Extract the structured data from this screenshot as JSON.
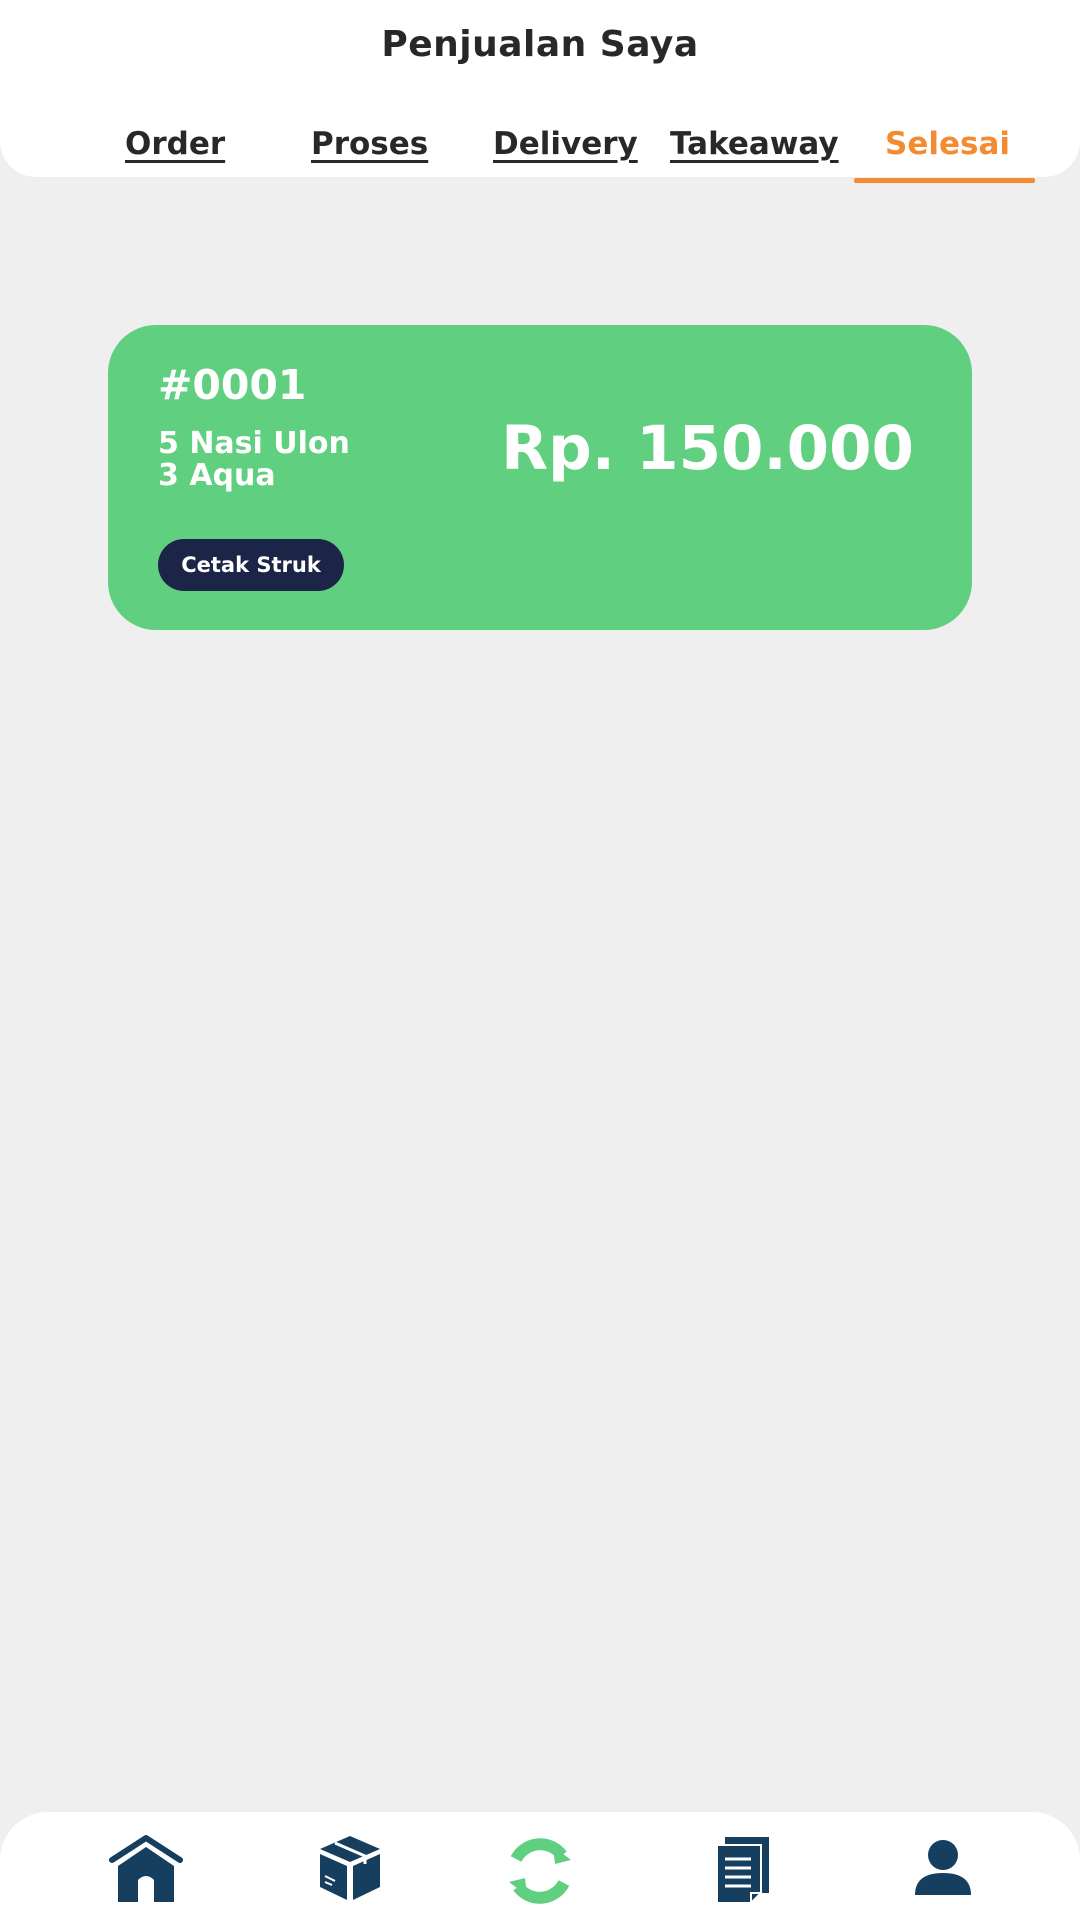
{
  "header": {
    "title": "Penjualan Saya",
    "tabs": [
      {
        "label": "Order"
      },
      {
        "label": "Proses"
      },
      {
        "label": "Delivery"
      },
      {
        "label": "Takeaway"
      },
      {
        "label": "Selesai",
        "active": true
      }
    ]
  },
  "orders": [
    {
      "id": "#0001",
      "items": [
        "5 Nasi Ulon",
        "3 Aqua"
      ],
      "total": "Rp. 150.000",
      "print_label": "Cetak Struk"
    }
  ],
  "bottom_nav": {
    "items": [
      {
        "icon": "home-icon"
      },
      {
        "icon": "package-icon"
      },
      {
        "icon": "sync-icon",
        "active": true
      },
      {
        "icon": "document-icon"
      },
      {
        "icon": "user-icon"
      }
    ]
  },
  "colors": {
    "accent": "#f48b30",
    "card": "#61cf80",
    "button": "#1c2447",
    "nav_icon": "#163f5f",
    "nav_active": "#61cf80",
    "background": "#efefef"
  }
}
